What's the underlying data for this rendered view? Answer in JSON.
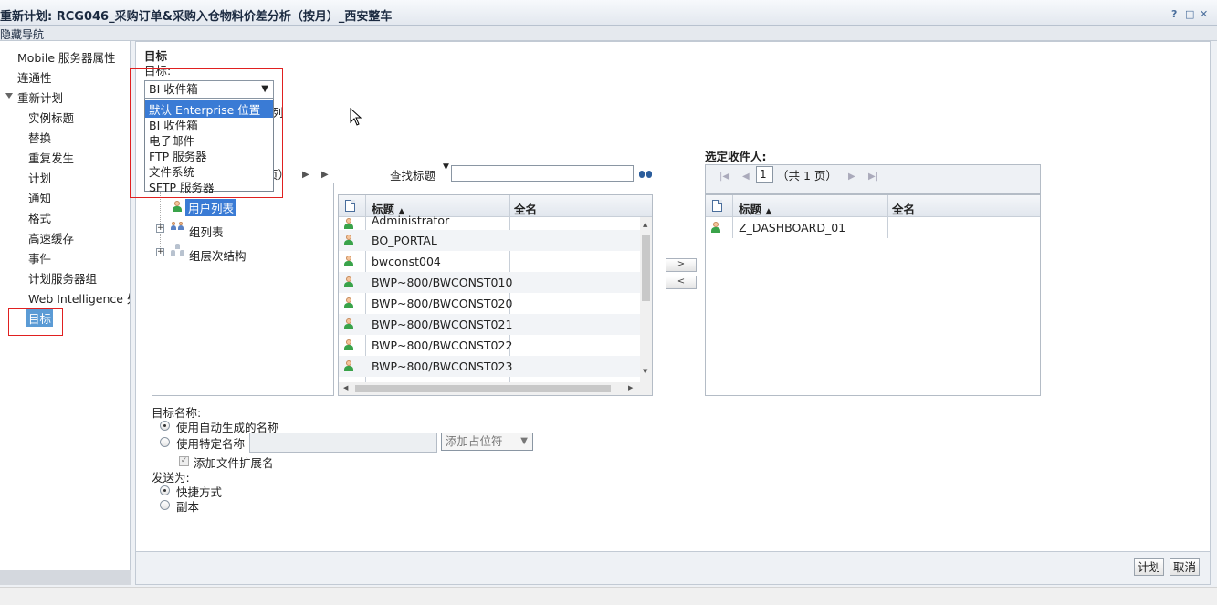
{
  "window": {
    "title": "重新计划: RCG046_采购订单&采购入仓物料价差分析（按月）_西安整车",
    "help": "?",
    "maximize": "□",
    "close": "✕"
  },
  "nav_toggle": "隐藏导航",
  "sidebar": {
    "items": [
      {
        "label": "Mobile 服务器属性"
      },
      {
        "label": "连通性"
      },
      {
        "label": "重新计划"
      },
      {
        "label": "实例标题"
      },
      {
        "label": "替换"
      },
      {
        "label": "重复发生"
      },
      {
        "label": "计划"
      },
      {
        "label": "通知"
      },
      {
        "label": "格式"
      },
      {
        "label": "高速缓存"
      },
      {
        "label": "事件"
      },
      {
        "label": "计划服务器组"
      },
      {
        "label": "Web Intelligence 处"
      },
      {
        "label": "目标"
      }
    ]
  },
  "main": {
    "section_title": "目标",
    "destination_label": "目标:",
    "destination_select": {
      "value": "BI 收件箱",
      "options": [
        "默认 Enterprise 位置",
        "BI 收件箱",
        "电子邮件",
        "FTP 服务器",
        "文件系统",
        "SFTP 服务器"
      ]
    },
    "peek_char": "列",
    "pager_partial": "页）",
    "search_label": "查找标题",
    "search_value": "",
    "tree": {
      "items": [
        "用户列表",
        "组列表",
        "组层次结构"
      ]
    },
    "available_table": {
      "columns": [
        "标题",
        "全名"
      ],
      "rows": [
        "Administrator",
        "BO_PORTAL",
        "bwconst004",
        "BWP~800/BWCONST010",
        "BWP~800/BWCONST020",
        "BWP~800/BWCONST021",
        "BWP~800/BWCONST022",
        "BWP~800/BWCONST023"
      ]
    },
    "move_right": ">",
    "move_left": "<",
    "selected_label": "选定收件人:",
    "selected_pager": {
      "page": "1",
      "total": "（共 1 页）"
    },
    "selected_table": {
      "columns": [
        "标题",
        "全名"
      ],
      "rows": [
        "Z_DASHBOARD_01"
      ]
    },
    "target_name_label": "目标名称:",
    "auto_name": "使用自动生成的名称",
    "specific_name": "使用特定名称",
    "specific_name_value": "",
    "placeholder_select": "添加占位符",
    "add_extension": "添加文件扩展名",
    "send_as_label": "发送为:",
    "shortcut": "快捷方式",
    "copy": "副本"
  },
  "footer": {
    "schedule": "计划",
    "cancel": "取消"
  }
}
